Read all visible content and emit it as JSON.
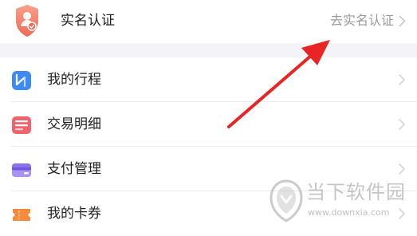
{
  "verification": {
    "title": "实名认证",
    "action_label": "去实名认证",
    "icon": "shield-user-icon"
  },
  "menu": {
    "items": [
      {
        "label": "我的行程",
        "icon": "route-icon"
      },
      {
        "label": "交易明细",
        "icon": "list-icon"
      },
      {
        "label": "支付管理",
        "icon": "card-icon"
      },
      {
        "label": "我的卡券",
        "icon": "ticket-icon"
      }
    ]
  },
  "watermark": {
    "brand": "当下软件园",
    "url": "www.downxia.com"
  },
  "colors": {
    "shield": "#f47e62",
    "route": "#3d8bf2",
    "list": "#f0636a",
    "card": "#8a72ee",
    "ticket": "#f78a3b",
    "arrow": "#e82424"
  }
}
